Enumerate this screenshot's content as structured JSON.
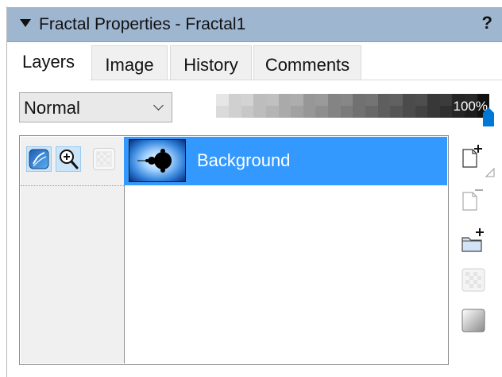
{
  "panel": {
    "title": "Fractal Properties - Fractal1",
    "help": "?"
  },
  "tabs": [
    {
      "label": "Layers",
      "active": true
    },
    {
      "label": "Image",
      "active": false
    },
    {
      "label": "History",
      "active": false
    },
    {
      "label": "Comments",
      "active": false
    }
  ],
  "blend_mode": {
    "value": "Normal"
  },
  "opacity": {
    "label": "100%",
    "value": 1.0
  },
  "layer_mode_buttons": [
    {
      "icon": "gradient-mode-icon",
      "selected": true
    },
    {
      "icon": "zoom-mode-icon",
      "selected": true
    },
    {
      "icon": "mask-mode-icon",
      "selected": false
    }
  ],
  "layers": [
    {
      "name": "Background",
      "selected": true
    }
  ],
  "side_tools": [
    {
      "icon": "add-layer-icon",
      "enabled": true
    },
    {
      "icon": "delete-layer-icon",
      "enabled": false
    },
    {
      "icon": "add-group-icon",
      "enabled": true
    },
    {
      "icon": "mask-layer-icon",
      "enabled": false
    },
    {
      "icon": "gradient-layer-icon",
      "enabled": true
    }
  ],
  "colors": {
    "titlebar": "#9fb6d1",
    "selection": "#3399ff",
    "accent": "#0078d7"
  }
}
